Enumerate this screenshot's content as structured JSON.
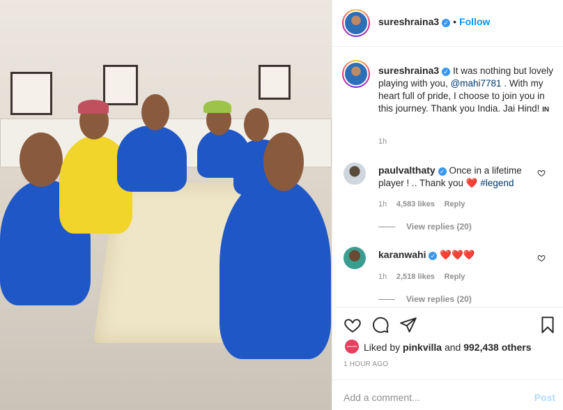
{
  "post": {
    "author": "sureshraina3",
    "follow_label": "Follow",
    "separator": "•",
    "caption_parts": [
      "It was nothing but lovely playing with you, ",
      "@mahi7781",
      " . With my heart full of pride, I choose to join you in this journey. Thank you India. Jai Hind! ",
      "🇮🇳"
    ],
    "caption_time": "1h",
    "flag_code": "IN"
  },
  "comments": [
    {
      "user": "paulvalthaty",
      "verified": true,
      "text": "Once in a lifetime player ! .. Thank you ",
      "emoji": "❤️",
      "hashtag": "#legend",
      "time": "1h",
      "likes": "4,583 likes",
      "reply": "Reply",
      "view_replies": "View replies (20)"
    },
    {
      "user": "karanwahi",
      "verified": true,
      "emojis": "❤️❤️❤️",
      "time": "1h",
      "likes": "2,518 likes",
      "reply": "Reply",
      "view_replies": "View replies (20)"
    }
  ],
  "likes": {
    "prefix": "Liked by ",
    "user": "pinkvilla",
    "middle": " and ",
    "others": "992,438 others",
    "avatar_label": "pinkvilla"
  },
  "post_time": "1 HOUR AGO",
  "comment_box": {
    "placeholder": "Add a comment...",
    "post_label": "Post"
  },
  "icons": {
    "like": "heart-icon",
    "comment": "comment-icon",
    "share": "share-icon",
    "save": "bookmark-icon"
  },
  "colors": {
    "link": "#0095f6",
    "mention": "#00376b",
    "heart": "#ed4956",
    "muted": "#8e8e8e"
  }
}
